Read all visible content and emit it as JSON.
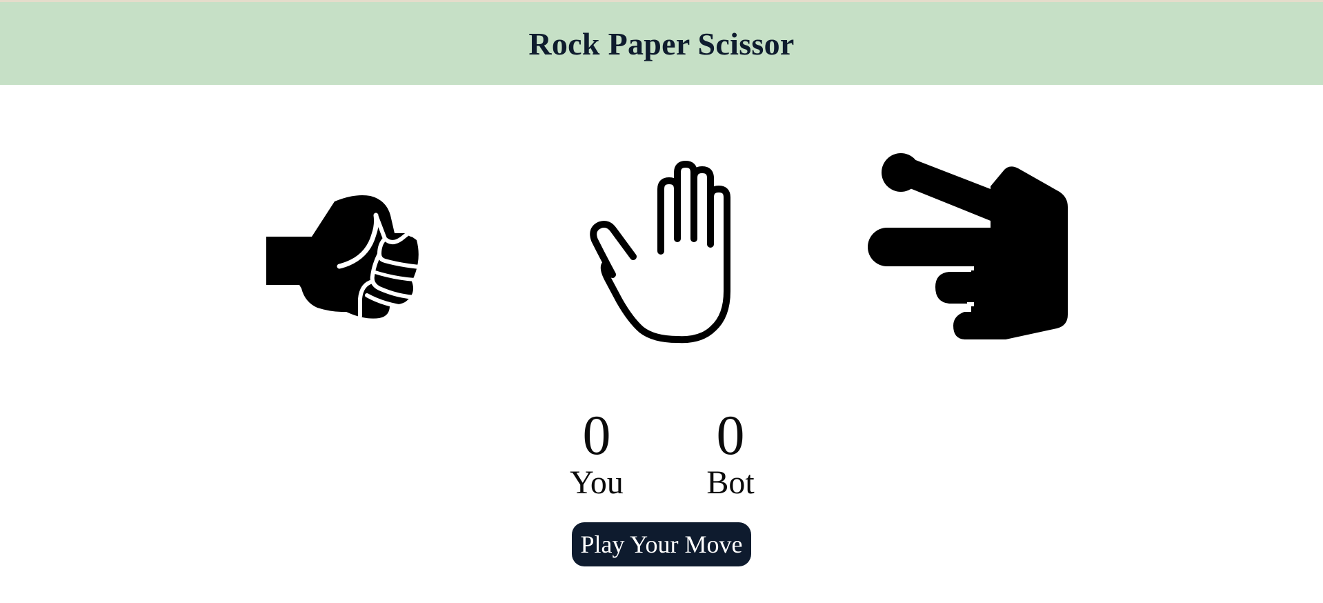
{
  "header": {
    "title": "Rock Paper Scissor",
    "background": "#c6e0c6",
    "title_color": "#0f1c2e"
  },
  "choices": [
    {
      "id": "rock",
      "icon": "fist-icon"
    },
    {
      "id": "paper",
      "icon": "open-hand-icon"
    },
    {
      "id": "scissor",
      "icon": "scissors-hand-icon"
    }
  ],
  "scoreboard": {
    "you": {
      "score": "0",
      "label": "You"
    },
    "bot": {
      "score": "0",
      "label": "Bot"
    }
  },
  "play_button": {
    "label": "Play Your Move",
    "background": "#0e1b2e",
    "text_color": "#ffffff"
  }
}
